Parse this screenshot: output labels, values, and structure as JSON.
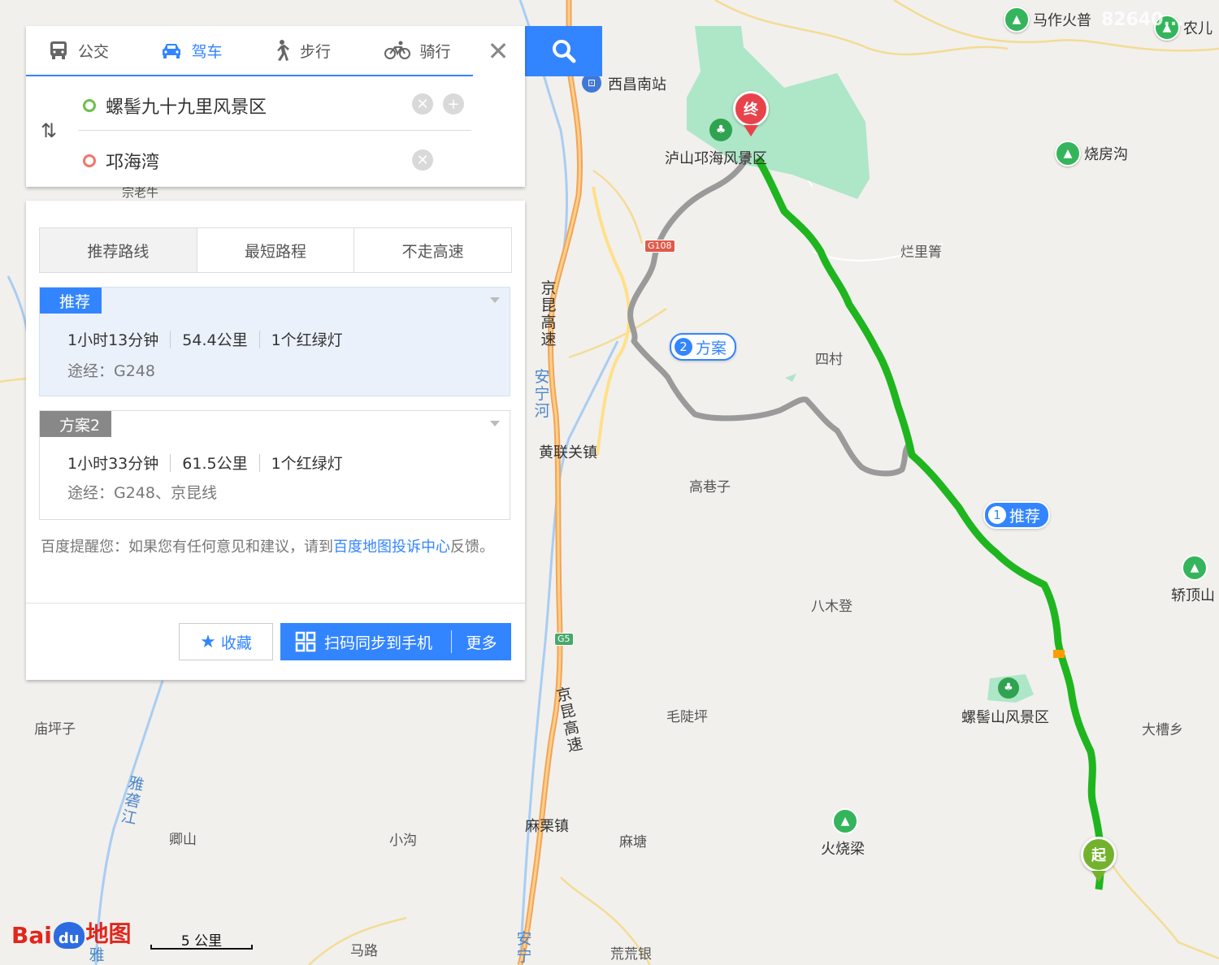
{
  "tabs": [
    {
      "label": "公交",
      "icon": "bus-icon"
    },
    {
      "label": "驾车",
      "icon": "car-icon",
      "active": true
    },
    {
      "label": "步行",
      "icon": "walk-icon"
    },
    {
      "label": "骑行",
      "icon": "bike-icon"
    }
  ],
  "origin": "螺髻九十九里风景区",
  "destination": "邛海湾",
  "route_tabs": [
    "推荐路线",
    "最短路程",
    "不走高速"
  ],
  "routes": [
    {
      "tag": "推荐",
      "time": "1小时13分钟",
      "distance": "54.4公里",
      "lights": "1个红绿灯",
      "via": "途经：G248"
    },
    {
      "tag": "方案2",
      "time": "1小时33分钟",
      "distance": "61.5公里",
      "lights": "1个红绿灯",
      "via": "途经：G248、京昆线"
    }
  ],
  "notice": {
    "before": "百度提醒您：如果您有任何意见和建议，请到",
    "link": "百度地图投诉中心",
    "after": "反馈。"
  },
  "buttons": {
    "favorite": "收藏",
    "sync": "扫码同步到手机",
    "more": "更多"
  },
  "map": {
    "places": {
      "xichang_south": "西昌南站",
      "lushan": "泸山邛海风景区",
      "lanlituo": "烂里箐",
      "sicun": "四村",
      "huanglianguan": "黄联关镇",
      "gaoxiangzi": "高巷子",
      "bamudeng": "八木登",
      "maopingzi": "毛陡坪",
      "luojishan": "螺髻山风景区",
      "dacaoxiang": "大槽乡",
      "miaopingzi": "庙坪子",
      "qingshan": "卿山",
      "xiaogou": "小沟",
      "malizhen": "麻栗镇",
      "matang": "麻塘",
      "huoshaoliang": "火烧梁",
      "malu": "马路",
      "huanghuangyin": "荒荒银",
      "mazuohuopu": "马作火普",
      "nonger": "农儿",
      "shaofanggou": "烧房沟",
      "jiaodingshan": "轿顶山",
      "zonglaoniu": "宗老牛"
    },
    "highway_1": "京昆高速",
    "highway_2": "京昆高速",
    "river_anning": "安宁河",
    "river_anning_2": "安宁",
    "river_yalong": "雅砻江",
    "river_ya": "雅",
    "shield_g108": "G108",
    "shield_g5": "G5",
    "bubble_plan2_num": "2",
    "bubble_plan2": "方案",
    "bubble_rec_num": "1",
    "bubble_rec": "推荐",
    "end_marker": "终",
    "start_marker": "起",
    "scale": "5 公里",
    "logo_bai": "Bai",
    "logo_du": "du",
    "logo_map": "地图",
    "watermark": "82640..."
  },
  "colors": {
    "accent": "#3385ff",
    "route_main": "#1fb51f",
    "route_alt": "#9e9e9e",
    "park": "#aee6c8"
  }
}
